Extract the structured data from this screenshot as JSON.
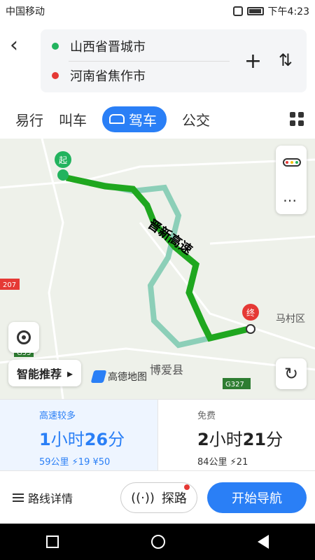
{
  "status_bar": {
    "carrier": "中国移动",
    "time": "下午4:23"
  },
  "route": {
    "start": "山西省晋城市",
    "end": "河南省焦作市",
    "start_color": "#22b35e",
    "end_color": "#e53935"
  },
  "tabs": [
    "易行",
    "叫车",
    "驾车",
    "公交"
  ],
  "active_tab_index": 2,
  "map": {
    "start_marker": "起",
    "end_marker": "终",
    "road_label": "晋新高速",
    "place_labels": [
      "马村区",
      "博爱县"
    ],
    "highway_labels": [
      "G55",
      "G327",
      "207"
    ],
    "logo_text": "高德地图",
    "smart_label": "智能推荐",
    "route_color": "#1fa71f",
    "alt_route_color": "#8ccfb8"
  },
  "options": [
    {
      "tag": "高速较多",
      "time_h": "1",
      "time_h_unit": "小时",
      "time_m": "26",
      "time_m_unit": "分",
      "meta": "59公里 ⚡19 ¥50"
    },
    {
      "tag": "免费",
      "time_h": "2",
      "time_h_unit": "小时",
      "time_m": "21",
      "time_m_unit": "分",
      "meta": "84公里 ⚡21"
    }
  ],
  "bottom": {
    "detail": "路线详情",
    "explore": "探路",
    "start_nav": "开始导航"
  }
}
